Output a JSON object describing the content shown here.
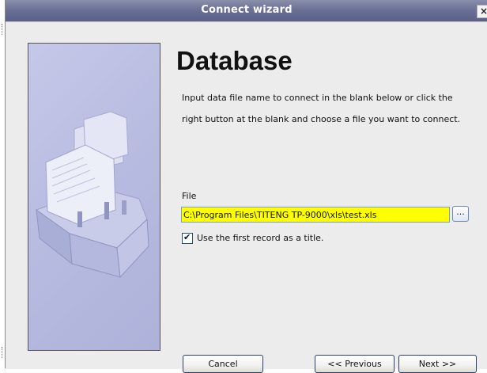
{
  "window": {
    "title": "Connect wizard",
    "close_glyph": "×"
  },
  "main": {
    "heading": "Database",
    "description": "Input data file name to connect in the blank below or click the right button at the blank and choose a file you want to connect.",
    "file_label": "File",
    "file_path": "C:\\Program Files\\TITENG TP-9000\\xls\\test.xls",
    "browse_label": "...",
    "first_record_label": "Use the first record as a title.",
    "first_record_checked": true,
    "checkmark": "✔"
  },
  "footer": {
    "cancel_label": "Cancel",
    "previous_label": "<< Previous",
    "next_label": "Next >>"
  },
  "side_image": {
    "icon": "card-file-index-icon",
    "background": "#b7bbe0"
  }
}
